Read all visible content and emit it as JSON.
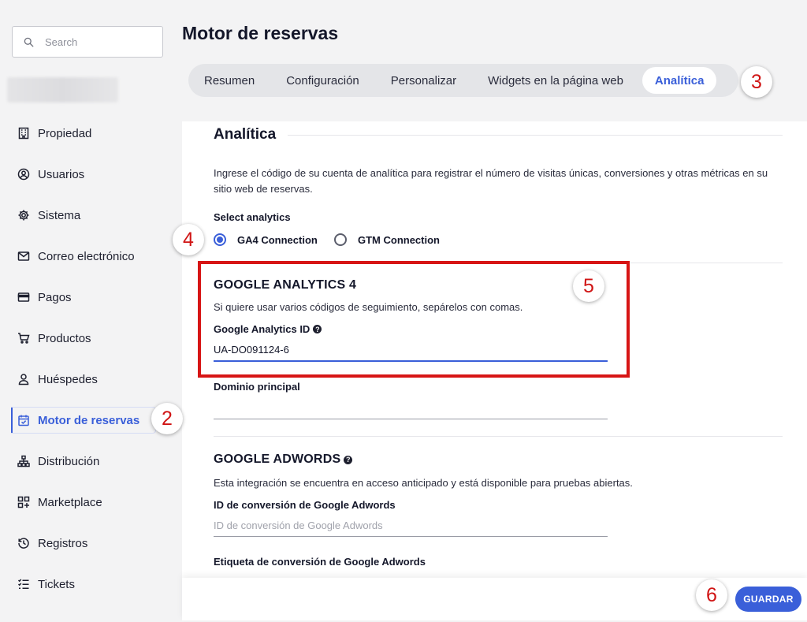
{
  "search": {
    "placeholder": "Search",
    "icon": "search-icon"
  },
  "sidebar": {
    "items": [
      {
        "label": "Propiedad",
        "icon": "building-icon"
      },
      {
        "label": "Usuarios",
        "icon": "user-circle-icon"
      },
      {
        "label": "Sistema",
        "icon": "gear-icon"
      },
      {
        "label": "Correo electrónico",
        "icon": "mail-icon"
      },
      {
        "label": "Pagos",
        "icon": "credit-card-icon"
      },
      {
        "label": "Productos",
        "icon": "cart-icon"
      },
      {
        "label": "Huéspedes",
        "icon": "person-icon"
      },
      {
        "label": "Motor de reservas",
        "icon": "calendar-check-icon",
        "active": true
      },
      {
        "label": "Distribución",
        "icon": "sitemap-icon"
      },
      {
        "label": "Marketplace",
        "icon": "apps-add-icon"
      },
      {
        "label": "Registros",
        "icon": "history-icon"
      },
      {
        "label": "Tickets",
        "icon": "checklist-icon"
      }
    ]
  },
  "header": {
    "title": "Motor de reservas",
    "tabs": [
      {
        "label": "Resumen"
      },
      {
        "label": "Configuración"
      },
      {
        "label": "Personalizar"
      },
      {
        "label": "Widgets en la página web"
      },
      {
        "label": "Analítica",
        "active": true
      }
    ]
  },
  "main": {
    "section_title": "Analítica",
    "intro": "Ingrese el código de su cuenta de analítica para registrar el número de visitas únicas, conversiones y otras métricas en su sitio web de reservas.",
    "select_label": "Select analytics",
    "radios": [
      {
        "label": "GA4 Connection",
        "checked": true
      },
      {
        "label": "GTM Connection",
        "checked": false
      }
    ],
    "ga4": {
      "title": "GOOGLE ANALYTICS 4",
      "description": "Si quiere usar varios códigos de seguimiento, sepárelos con comas.",
      "id_label": "Google Analytics ID",
      "id_value": "UA-DO091124-6",
      "domain_label": "Dominio principal",
      "domain_value": ""
    },
    "adwords": {
      "title": "GOOGLE ADWORDS",
      "description": "Esta integración se encuentra en acceso anticipado y está disponible para pruebas abiertas.",
      "conversion_id_label": "ID de conversión de Google Adwords",
      "conversion_id_placeholder": "ID de conversión de Google Adwords",
      "conversion_tag_label": "Etiqueta de conversión de Google Adwords"
    }
  },
  "footer": {
    "save_label": "GUARDAR"
  },
  "annotations": {
    "m2": "2",
    "m3": "3",
    "m4": "4",
    "m5": "5",
    "m6": "6",
    "color": "#d01414"
  },
  "colors": {
    "accent": "#3a5fd9",
    "highlight": "#d71515"
  }
}
